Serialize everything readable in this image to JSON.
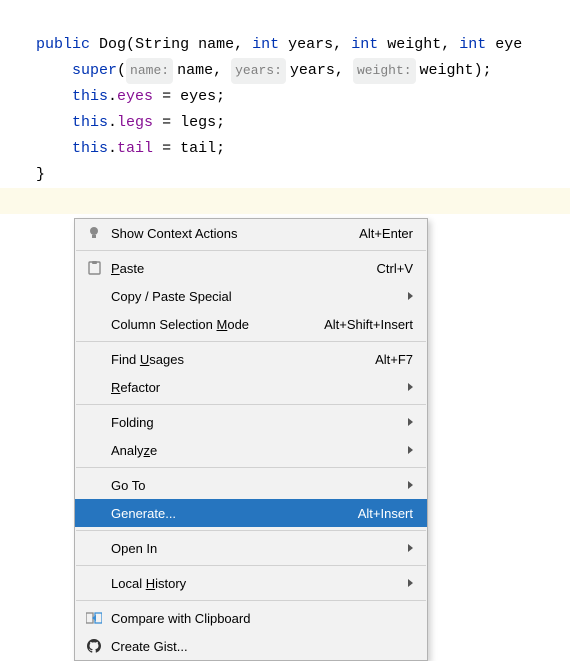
{
  "code": {
    "kw_public": "public",
    "cls": "Dog",
    "type_string": "String",
    "p_name": "name",
    "type_int": "int",
    "p_years": "years",
    "p_weight": "weight",
    "p_eye": "eye",
    "kw_super": "super",
    "hint_name": "name:",
    "hint_years": "years:",
    "hint_weight": "weight:",
    "arg_name": "name",
    "arg_years": "years",
    "arg_weight": "weight",
    "kw_this": "this",
    "f_eyes": "eyes",
    "v_eyes": "eyes",
    "f_legs": "legs",
    "v_legs": "legs",
    "f_tail": "tail",
    "v_tail": "tail",
    "brace_close": "}"
  },
  "menu": {
    "context_actions": {
      "label": "Show Context Actions",
      "shortcut": "Alt+Enter"
    },
    "paste": {
      "label_pre": "",
      "label_u": "P",
      "label_post": "aste",
      "shortcut": "Ctrl+V"
    },
    "copy_paste_special": {
      "label": "Copy / Paste Special"
    },
    "column_mode": {
      "label_pre": "Column Selection ",
      "label_u": "M",
      "label_post": "ode",
      "shortcut": "Alt+Shift+Insert"
    },
    "find_usages": {
      "label_pre": "Find ",
      "label_u": "U",
      "label_post": "sages",
      "shortcut": "Alt+F7"
    },
    "refactor": {
      "label_pre": "",
      "label_u": "R",
      "label_post": "efactor"
    },
    "folding": {
      "label": "Folding"
    },
    "analyze": {
      "label_pre": "Analy",
      "label_u": "z",
      "label_post": "e"
    },
    "go_to": {
      "label": "Go To"
    },
    "generate": {
      "label": "Generate...",
      "shortcut": "Alt+Insert"
    },
    "open_in": {
      "label": "Open In"
    },
    "local_history": {
      "label_pre": "Local ",
      "label_u": "H",
      "label_post": "istory"
    },
    "compare_clip": {
      "label": "Compare with Clipboard"
    },
    "create_gist": {
      "label": "Create Gist..."
    }
  }
}
